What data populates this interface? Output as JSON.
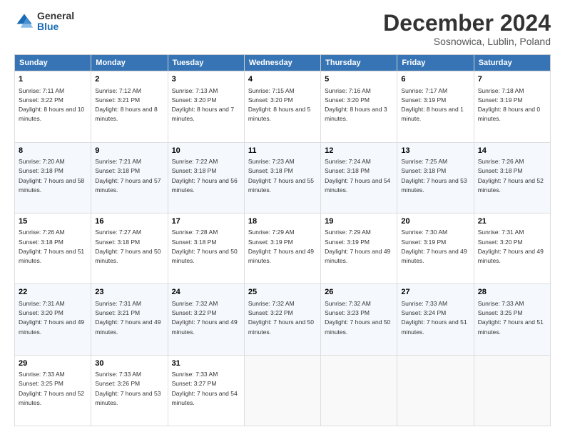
{
  "logo": {
    "general": "General",
    "blue": "Blue"
  },
  "title": "December 2024",
  "subtitle": "Sosnowica, Lublin, Poland",
  "headers": [
    "Sunday",
    "Monday",
    "Tuesday",
    "Wednesday",
    "Thursday",
    "Friday",
    "Saturday"
  ],
  "weeks": [
    [
      {
        "day": "1",
        "sunrise": "Sunrise: 7:11 AM",
        "sunset": "Sunset: 3:22 PM",
        "daylight": "Daylight: 8 hours and 10 minutes."
      },
      {
        "day": "2",
        "sunrise": "Sunrise: 7:12 AM",
        "sunset": "Sunset: 3:21 PM",
        "daylight": "Daylight: 8 hours and 8 minutes."
      },
      {
        "day": "3",
        "sunrise": "Sunrise: 7:13 AM",
        "sunset": "Sunset: 3:20 PM",
        "daylight": "Daylight: 8 hours and 7 minutes."
      },
      {
        "day": "4",
        "sunrise": "Sunrise: 7:15 AM",
        "sunset": "Sunset: 3:20 PM",
        "daylight": "Daylight: 8 hours and 5 minutes."
      },
      {
        "day": "5",
        "sunrise": "Sunrise: 7:16 AM",
        "sunset": "Sunset: 3:20 PM",
        "daylight": "Daylight: 8 hours and 3 minutes."
      },
      {
        "day": "6",
        "sunrise": "Sunrise: 7:17 AM",
        "sunset": "Sunset: 3:19 PM",
        "daylight": "Daylight: 8 hours and 1 minute."
      },
      {
        "day": "7",
        "sunrise": "Sunrise: 7:18 AM",
        "sunset": "Sunset: 3:19 PM",
        "daylight": "Daylight: 8 hours and 0 minutes."
      }
    ],
    [
      {
        "day": "8",
        "sunrise": "Sunrise: 7:20 AM",
        "sunset": "Sunset: 3:18 PM",
        "daylight": "Daylight: 7 hours and 58 minutes."
      },
      {
        "day": "9",
        "sunrise": "Sunrise: 7:21 AM",
        "sunset": "Sunset: 3:18 PM",
        "daylight": "Daylight: 7 hours and 57 minutes."
      },
      {
        "day": "10",
        "sunrise": "Sunrise: 7:22 AM",
        "sunset": "Sunset: 3:18 PM",
        "daylight": "Daylight: 7 hours and 56 minutes."
      },
      {
        "day": "11",
        "sunrise": "Sunrise: 7:23 AM",
        "sunset": "Sunset: 3:18 PM",
        "daylight": "Daylight: 7 hours and 55 minutes."
      },
      {
        "day": "12",
        "sunrise": "Sunrise: 7:24 AM",
        "sunset": "Sunset: 3:18 PM",
        "daylight": "Daylight: 7 hours and 54 minutes."
      },
      {
        "day": "13",
        "sunrise": "Sunrise: 7:25 AM",
        "sunset": "Sunset: 3:18 PM",
        "daylight": "Daylight: 7 hours and 53 minutes."
      },
      {
        "day": "14",
        "sunrise": "Sunrise: 7:26 AM",
        "sunset": "Sunset: 3:18 PM",
        "daylight": "Daylight: 7 hours and 52 minutes."
      }
    ],
    [
      {
        "day": "15",
        "sunrise": "Sunrise: 7:26 AM",
        "sunset": "Sunset: 3:18 PM",
        "daylight": "Daylight: 7 hours and 51 minutes."
      },
      {
        "day": "16",
        "sunrise": "Sunrise: 7:27 AM",
        "sunset": "Sunset: 3:18 PM",
        "daylight": "Daylight: 7 hours and 50 minutes."
      },
      {
        "day": "17",
        "sunrise": "Sunrise: 7:28 AM",
        "sunset": "Sunset: 3:18 PM",
        "daylight": "Daylight: 7 hours and 50 minutes."
      },
      {
        "day": "18",
        "sunrise": "Sunrise: 7:29 AM",
        "sunset": "Sunset: 3:19 PM",
        "daylight": "Daylight: 7 hours and 49 minutes."
      },
      {
        "day": "19",
        "sunrise": "Sunrise: 7:29 AM",
        "sunset": "Sunset: 3:19 PM",
        "daylight": "Daylight: 7 hours and 49 minutes."
      },
      {
        "day": "20",
        "sunrise": "Sunrise: 7:30 AM",
        "sunset": "Sunset: 3:19 PM",
        "daylight": "Daylight: 7 hours and 49 minutes."
      },
      {
        "day": "21",
        "sunrise": "Sunrise: 7:31 AM",
        "sunset": "Sunset: 3:20 PM",
        "daylight": "Daylight: 7 hours and 49 minutes."
      }
    ],
    [
      {
        "day": "22",
        "sunrise": "Sunrise: 7:31 AM",
        "sunset": "Sunset: 3:20 PM",
        "daylight": "Daylight: 7 hours and 49 minutes."
      },
      {
        "day": "23",
        "sunrise": "Sunrise: 7:31 AM",
        "sunset": "Sunset: 3:21 PM",
        "daylight": "Daylight: 7 hours and 49 minutes."
      },
      {
        "day": "24",
        "sunrise": "Sunrise: 7:32 AM",
        "sunset": "Sunset: 3:22 PM",
        "daylight": "Daylight: 7 hours and 49 minutes."
      },
      {
        "day": "25",
        "sunrise": "Sunrise: 7:32 AM",
        "sunset": "Sunset: 3:22 PM",
        "daylight": "Daylight: 7 hours and 50 minutes."
      },
      {
        "day": "26",
        "sunrise": "Sunrise: 7:32 AM",
        "sunset": "Sunset: 3:23 PM",
        "daylight": "Daylight: 7 hours and 50 minutes."
      },
      {
        "day": "27",
        "sunrise": "Sunrise: 7:33 AM",
        "sunset": "Sunset: 3:24 PM",
        "daylight": "Daylight: 7 hours and 51 minutes."
      },
      {
        "day": "28",
        "sunrise": "Sunrise: 7:33 AM",
        "sunset": "Sunset: 3:25 PM",
        "daylight": "Daylight: 7 hours and 51 minutes."
      }
    ],
    [
      {
        "day": "29",
        "sunrise": "Sunrise: 7:33 AM",
        "sunset": "Sunset: 3:25 PM",
        "daylight": "Daylight: 7 hours and 52 minutes."
      },
      {
        "day": "30",
        "sunrise": "Sunrise: 7:33 AM",
        "sunset": "Sunset: 3:26 PM",
        "daylight": "Daylight: 7 hours and 53 minutes."
      },
      {
        "day": "31",
        "sunrise": "Sunrise: 7:33 AM",
        "sunset": "Sunset: 3:27 PM",
        "daylight": "Daylight: 7 hours and 54 minutes."
      },
      null,
      null,
      null,
      null
    ]
  ]
}
